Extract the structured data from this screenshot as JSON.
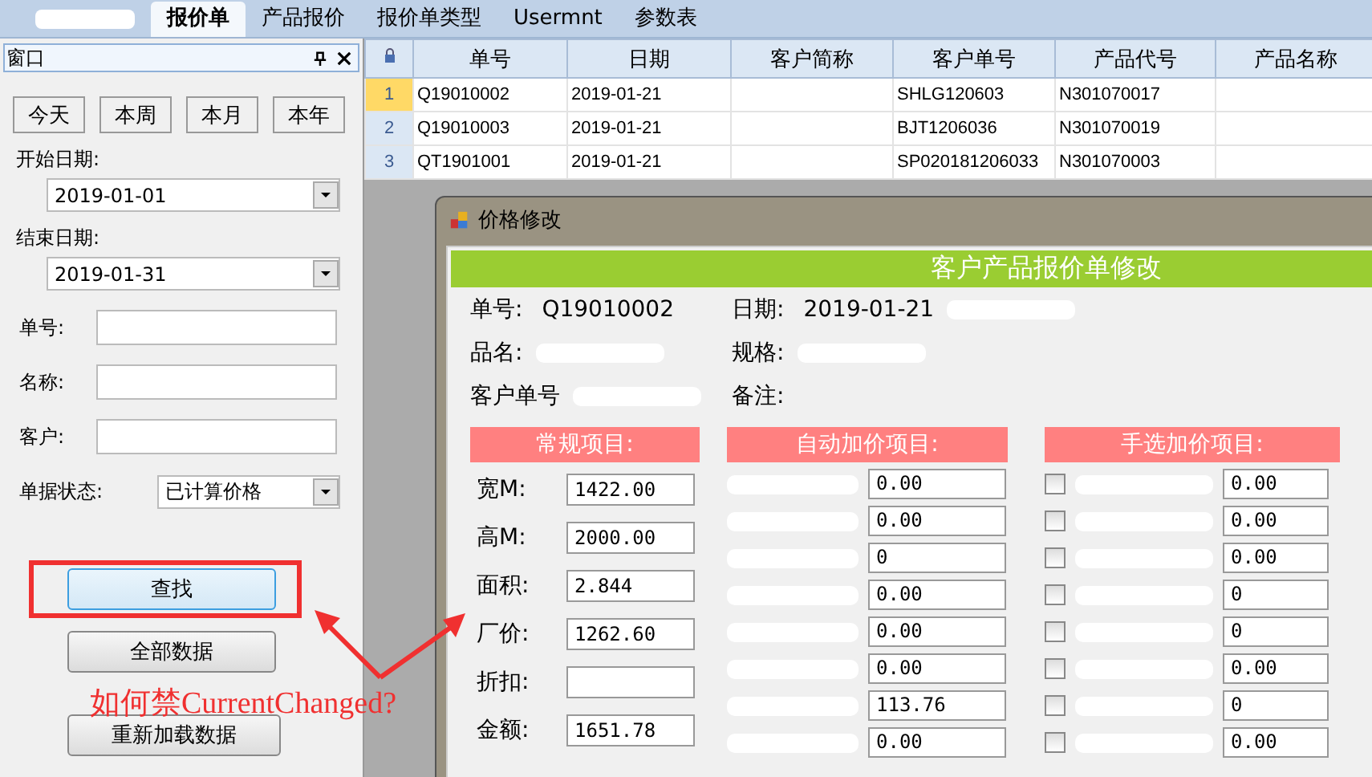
{
  "tabs": [
    {
      "kind": "redacted",
      "selected": false
    },
    {
      "kind": "text",
      "label": "报价单",
      "selected": true
    },
    {
      "kind": "text",
      "label": "产品报价",
      "selected": false
    },
    {
      "kind": "text",
      "label": "报价单类型",
      "selected": false
    },
    {
      "kind": "text",
      "label": "Usermnt",
      "selected": false
    },
    {
      "kind": "text",
      "label": "参数表",
      "selected": false
    }
  ],
  "side_panel": {
    "title": "窗口",
    "quick_buttons": [
      "今天",
      "本周",
      "本月",
      "本年"
    ],
    "start_date_label": "开始日期:",
    "start_date": "2019-01-01",
    "end_date_label": "结束日期:",
    "end_date": "2019-01-31",
    "fields": [
      {
        "label": "单号:"
      },
      {
        "label": "名称:"
      },
      {
        "label": "客户:"
      }
    ],
    "status_label": "单据状态:",
    "status_value": "已计算价格",
    "buttons": [
      {
        "label": "查找",
        "focused": true,
        "highlighted": true
      },
      {
        "label": "全部数据",
        "focused": false,
        "highlighted": false
      },
      {
        "label": "重新加载数据",
        "focused": false,
        "highlighted": false
      }
    ]
  },
  "grid": {
    "columns": [
      "单号",
      "日期",
      "客户简称",
      "客户单号",
      "产品代号",
      "产品名称"
    ],
    "rows": [
      {
        "index": "1",
        "selected": true,
        "cells": [
          "Q19010002",
          "2019-01-21",
          "",
          "SHLG120603",
          "N301070017",
          ""
        ]
      },
      {
        "index": "2",
        "selected": false,
        "cells": [
          "Q19010003",
          "2019-01-21",
          "",
          "BJT1206036",
          "N301070019",
          ""
        ]
      },
      {
        "index": "3",
        "selected": false,
        "cells": [
          "QT1901001",
          "2019-01-21",
          "",
          "SP020181206033",
          "N301070003",
          ""
        ]
      }
    ]
  },
  "dialog": {
    "title": "价格修改",
    "banner": "客户产品报价单修改",
    "info": [
      [
        {
          "label": "单号:",
          "value": "Q19010002"
        },
        {
          "label": "日期:",
          "value": "2019-01-21",
          "redacted": true
        }
      ],
      [
        {
          "label": "品名:",
          "redacted": true
        },
        {
          "label": "规格:",
          "redacted": true
        }
      ],
      [
        {
          "label": "客户单号",
          "redacted": true
        },
        {
          "label": "备注:"
        }
      ]
    ],
    "regular": {
      "title": "常规项目:",
      "rows": [
        {
          "label": "宽M:",
          "value": "1422.00"
        },
        {
          "label": "高M:",
          "value": "2000.00"
        },
        {
          "label": "面积:",
          "value": "2.844"
        },
        {
          "label": "厂价:",
          "value": "1262.60"
        },
        {
          "label": "折扣:"
        },
        {
          "label": "金额:",
          "value": "1651.78"
        }
      ]
    },
    "auto": {
      "title": "自动加价项目:",
      "values": [
        "0.00",
        "0.00",
        "0",
        "0.00",
        "0.00",
        "0.00",
        "113.76",
        "0.00"
      ]
    },
    "manual": {
      "title": "手选加价项目:",
      "rows": [
        {
          "checked": false,
          "value": "0.00"
        },
        {
          "checked": false,
          "value": "0.00"
        },
        {
          "checked": false,
          "value": "0.00"
        },
        {
          "checked": false,
          "value": "0"
        },
        {
          "checked": false,
          "value": "0"
        },
        {
          "checked": false,
          "value": "0.00"
        },
        {
          "checked": false,
          "value": "0"
        },
        {
          "checked": false,
          "value": "0.00"
        }
      ]
    }
  },
  "annotation": {
    "question": "如何禁CurrentChanged?"
  }
}
